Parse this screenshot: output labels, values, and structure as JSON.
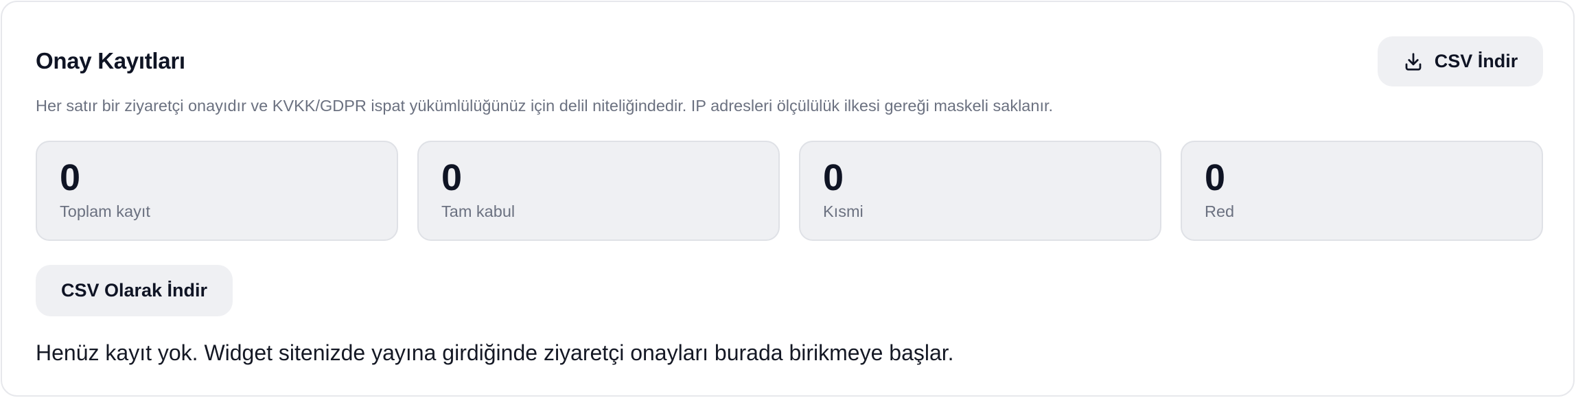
{
  "header": {
    "title": "Onay Kayıtları",
    "download_button_label": "CSV İndir",
    "download_icon": "download-icon"
  },
  "description": "Her satır bir ziyaretçi onayıdır ve KVKK/GDPR ispat yükümlülüğünüz için delil niteliğindedir. IP adresleri ölçülülük ilkesi gereği maskeli saklanır.",
  "stats": [
    {
      "value": "0",
      "label": "Toplam kayıt"
    },
    {
      "value": "0",
      "label": "Tam kabul"
    },
    {
      "value": "0",
      "label": "Kısmi"
    },
    {
      "value": "0",
      "label": "Red"
    }
  ],
  "export_button_label": "CSV Olarak İndir",
  "empty_state": "Henüz kayıt yok. Widget sitenizde yayına girdiğinde ziyaretçi onayları burada birikmeye başlar.",
  "colors": {
    "text_primary": "#0f1424",
    "text_muted": "#6b7180",
    "surface": "#eff0f3",
    "border": "#e7e8ec"
  }
}
